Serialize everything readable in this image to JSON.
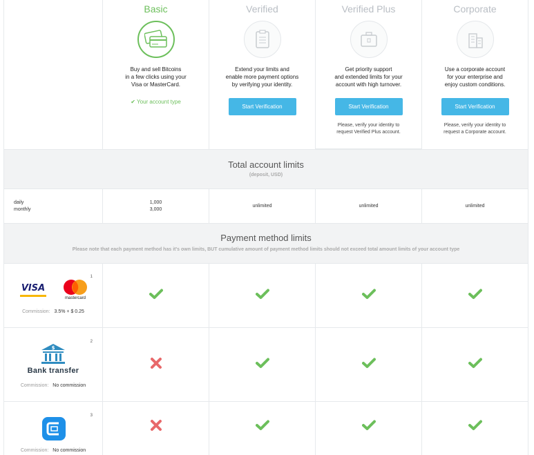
{
  "plans": [
    {
      "title": "Basic",
      "icon": "credit-cards-icon",
      "desc": [
        "Buy and sell Bitcoins",
        "in a few clicks using your",
        "Visa or MasterCard."
      ],
      "status": "Your account type"
    },
    {
      "title": "Verified",
      "icon": "clipboard-icon",
      "desc": [
        "Extend your limits and",
        "enable more payment options",
        "by verifying your identity."
      ],
      "button": "Start Verification"
    },
    {
      "title": "Verified Plus",
      "icon": "briefcase-icon",
      "desc": [
        "Get priority support",
        "and extended limits for your",
        "account with high turnover."
      ],
      "button": "Start Verification",
      "note": [
        "Please, verify your identity to",
        "request Verified Plus account."
      ]
    },
    {
      "title": "Corporate",
      "icon": "building-icon",
      "desc": [
        "Use a corporate account",
        "for your enterprise and",
        "enjoy custom conditions."
      ],
      "button": "Start Verification",
      "note": [
        "Please, verify your identity to",
        "request a Corporate account."
      ]
    }
  ],
  "total_limits": {
    "title": "Total account limits",
    "sub": "(deposit, USD)",
    "labels": [
      "daily",
      "monthly"
    ],
    "basic": [
      "1,000",
      "3,000"
    ],
    "verified": "unlimited",
    "verified_plus": "unlimited",
    "corporate": "unlimited"
  },
  "payment_limits": {
    "title": "Payment method limits",
    "sub": "Please note that each payment method has it's own limits, BUT cumulative amount of payment method limits should not exceed total amount limits of your account type"
  },
  "methods": [
    {
      "sup": "1",
      "visa": "VISA",
      "mastercard": "mastercard",
      "commission_label": "Commission:",
      "commission": "3.5% + $ 0.25",
      "available": [
        true,
        true,
        true,
        true
      ]
    },
    {
      "sup": "2",
      "name": "Bank transfer",
      "commission_label": "Commission:",
      "commission": "No commission",
      "available": [
        false,
        true,
        true,
        true
      ]
    },
    {
      "sup": "3",
      "commission_label": "Commission:",
      "commission": "No commission",
      "available": [
        false,
        true,
        true,
        true
      ]
    }
  ],
  "colors": {
    "green": "#6cbf5b",
    "blue": "#45b7e6",
    "red": "#e8686a",
    "bank": "#2f8cc0"
  }
}
